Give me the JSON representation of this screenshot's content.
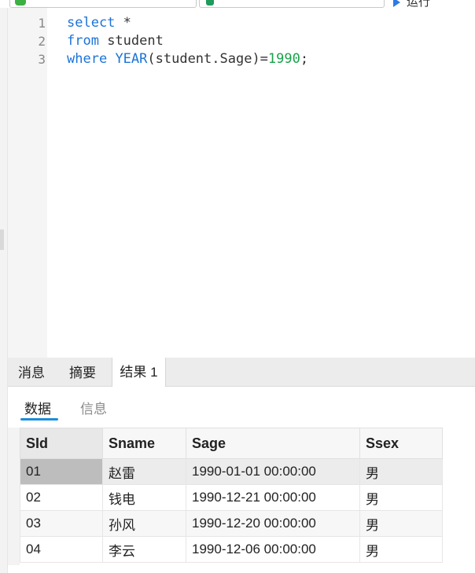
{
  "toolbar": {
    "run_label": "运行"
  },
  "editor": {
    "lines": [
      {
        "num": "1",
        "kw1": "select",
        "rest1": " *"
      },
      {
        "num": "2",
        "kw1": "from",
        "rest1": " student"
      },
      {
        "num": "3",
        "kw1": "where",
        "sp": " ",
        "fn": "YEAR",
        "rest1": "(student.Sage)=",
        "num_lit": "1990",
        "end": ";"
      }
    ]
  },
  "result_tabs": [
    "消息",
    "摘要",
    "结果 1"
  ],
  "sub_tabs": {
    "data": "数据",
    "info": "信息"
  },
  "grid": {
    "columns": [
      "SId",
      "Sname",
      "Sage",
      "Ssex"
    ],
    "rows": [
      [
        "01",
        "赵雷",
        "1990-01-01 00:00:00",
        "男"
      ],
      [
        "02",
        "钱电",
        "1990-12-21 00:00:00",
        "男"
      ],
      [
        "03",
        "孙风",
        "1990-12-20 00:00:00",
        "男"
      ],
      [
        "04",
        "李云",
        "1990-12-06 00:00:00",
        "男"
      ]
    ]
  },
  "colors": {
    "keyword": "#1a74d8",
    "number": "#1aa14a",
    "accent": "#1a8fd8"
  }
}
